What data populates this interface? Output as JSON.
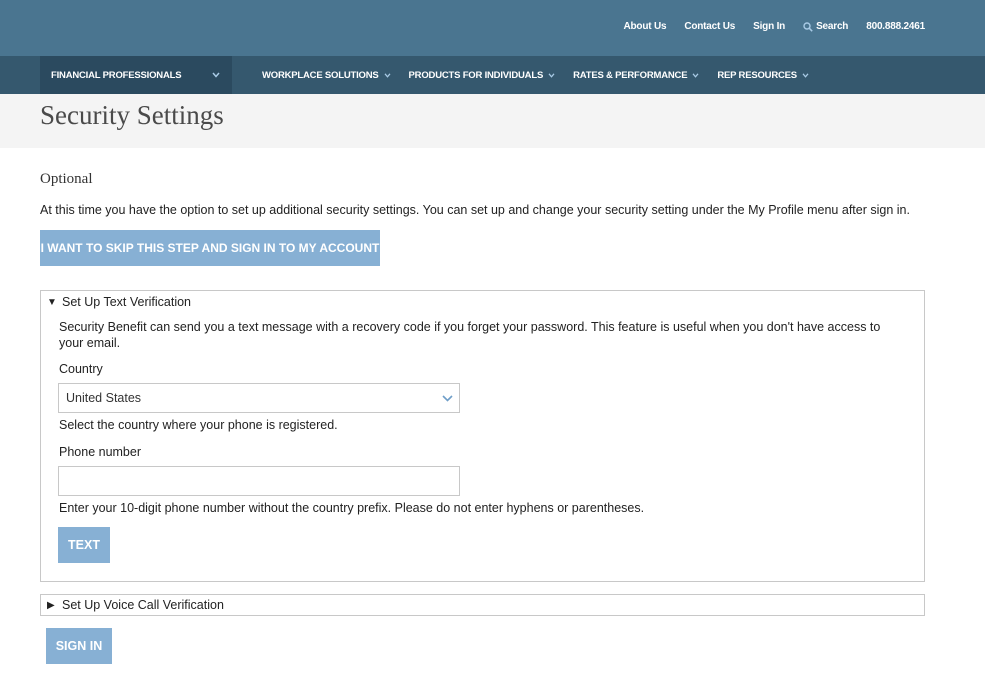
{
  "header": {
    "links": {
      "about": "About Us",
      "contact": "Contact Us",
      "signin": "Sign In",
      "search": "Search",
      "phone": "800.888.2461"
    }
  },
  "nav": {
    "primary": "FINANCIAL PROFESSIONALS",
    "items": [
      {
        "label": "WORKPLACE SOLUTIONS"
      },
      {
        "label": "PRODUCTS FOR INDIVIDUALS"
      },
      {
        "label": "RATES & PERFORMANCE"
      },
      {
        "label": "REP RESOURCES"
      }
    ]
  },
  "page": {
    "title": "Security Settings",
    "optional_heading": "Optional",
    "intro": "At this time you have the option to set up additional security settings. You can set up and change your security setting under the My Profile menu after sign in.",
    "skip_button": "I WANT TO SKIP THIS STEP AND SIGN IN TO MY ACCOUNT"
  },
  "text_verification": {
    "summary": "Set Up Text Verification",
    "expanded_glyph": "▼",
    "description": "Security Benefit can send you a text message with a recovery code if you forget your password. This feature is useful when you don't have access to your email.",
    "country_label": "Country",
    "country_value": "United States",
    "country_help": "Select the country where your phone is registered.",
    "phone_label": "Phone number",
    "phone_value": "",
    "phone_help": "Enter your 10-digit phone number without the country prefix. Please do not enter hyphens or parentheses.",
    "text_button": "TEXT"
  },
  "voice_verification": {
    "summary": "Set Up Voice Call Verification",
    "collapsed_glyph": "▶"
  },
  "signin_button": "SIGN IN",
  "colors": {
    "topbar": "#4a7590",
    "navbar": "#35586e",
    "nav_primary": "#2b4a5f",
    "button": "#87b0d4"
  }
}
